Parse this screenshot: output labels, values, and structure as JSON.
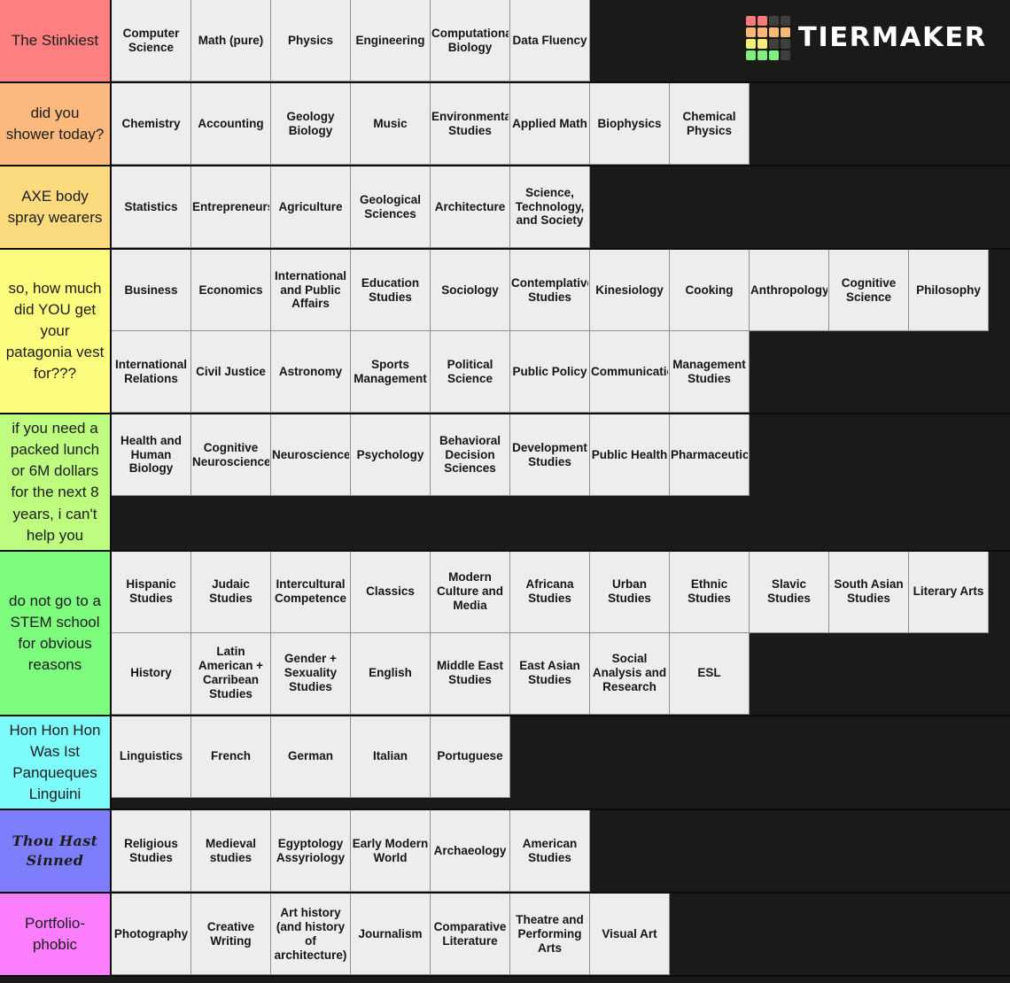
{
  "watermark": {
    "brand": "TiERMAKER",
    "logo_name": "tiermaker-logo",
    "logo_colors": {
      "red": "#f97a7a",
      "orange": "#f7b878",
      "yellow": "#f6f07a",
      "green": "#7ef07e",
      "dark": "#3f3f3d"
    },
    "logo_pattern": [
      [
        "red",
        "red",
        "dark",
        "dark"
      ],
      [
        "orange",
        "orange",
        "orange",
        "orange"
      ],
      [
        "yellow",
        "yellow",
        "dark",
        "dark"
      ],
      [
        "green",
        "green",
        "green",
        "dark"
      ]
    ]
  },
  "background_color": "#1a1a18",
  "item_color": "#ededed",
  "tiers": [
    {
      "label": "The Stinkiest",
      "color": "#fd7f7f",
      "items": [
        "Computer Science",
        "Math (pure)",
        "Physics",
        "Engineering",
        "Computational Biology",
        "Data Fluency"
      ]
    },
    {
      "label": "did you shower today?",
      "color": "#fcb97e",
      "items": [
        "Chemistry",
        "Accounting",
        "Geology Biology",
        "Music",
        "Environmental Studies",
        "Applied Math",
        "Biophysics",
        "Chemical Physics"
      ]
    },
    {
      "label": "AXE body spray wearers",
      "color": "#fcdb7f",
      "items": [
        "Statistics",
        "Entrepreneurship",
        "Agriculture",
        "Geological Sciences",
        "Architecture",
        "Science, Technology, and Society"
      ]
    },
    {
      "label": "so, how much did YOU get your patagonia vest for???",
      "color": "#fcfc7e",
      "items": [
        "Business",
        "Economics",
        "International and Public Affairs",
        "Education Studies",
        "Sociology",
        "Contemplative Studies",
        "Kinesiology",
        "Cooking",
        "Anthropology",
        "Cognitive Science",
        "Philosophy",
        "International Relations",
        "Civil Justice",
        "Astronomy",
        "Sports Management",
        "Political Science",
        "Public Policy",
        "Communications",
        "Management Studies"
      ]
    },
    {
      "label": "if you need a packed lunch or 6M dollars for the next 8 years, i can't help you",
      "color": "#bdfc7f",
      "items": [
        "Health and Human Biology",
        "Cognitive Neuroscience",
        "Neuroscience",
        "Psychology",
        "Behavioral Decision Sciences",
        "Development Studies",
        "Public Health",
        "Pharmaceutics"
      ]
    },
    {
      "label": "do not go to a STEM school for obvious reasons",
      "color": "#7efc7e",
      "items": [
        "Hispanic Studies",
        "Judaic Studies",
        "Intercultural Competence",
        "Classics",
        "Modern Culture and Media",
        "Africana Studies",
        "Urban Studies",
        "Ethnic Studies",
        "Slavic Studies",
        "South Asian Studies",
        "Literary Arts",
        "History",
        "Latin American + Carribean Studies",
        "Gender + Sexuality Studies",
        "English",
        "Middle East Studies",
        "East Asian Studies",
        "Social Analysis and Research",
        "ESL"
      ]
    },
    {
      "label": "Hon Hon Hon Was Ist Panqueques Linguini",
      "color": "#7efcfc",
      "items": [
        "Linguistics",
        "French",
        "German",
        "Italian",
        "Portuguese"
      ]
    },
    {
      "label": "Thou Hast Sinned",
      "color": "#7e7efc",
      "gothic": true,
      "items": [
        "Religious Studies",
        "Medieval studies",
        "Egyptology Assyriology",
        "Early Modern World",
        "Archaeology",
        "American Studies"
      ]
    },
    {
      "label": "Portfolio-phobic",
      "color": "#fc7efc",
      "items": [
        "Photography",
        "Creative Writing",
        "Art history (and history of architecture)",
        "Journalism",
        "Comparative Literature",
        "Theatre and Performing Arts",
        "Visual Art"
      ]
    }
  ]
}
